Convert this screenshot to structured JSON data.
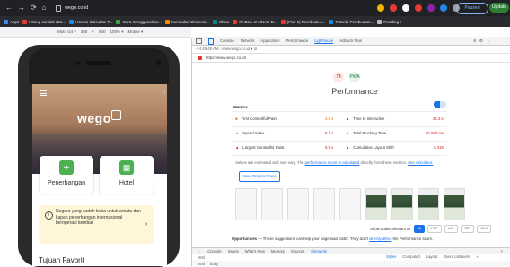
{
  "browser": {
    "url": "wego.co.id",
    "nav_glyphs": [
      "←",
      "→",
      "⟳",
      "⌂"
    ],
    "paused_label": "Paused",
    "update_label": "Update",
    "bookmarks": [
      {
        "label": "Apps",
        "color": "#4285f4"
      },
      {
        "label": "Hitung Jumlah (Da...",
        "color": "#e53935"
      },
      {
        "label": "How to Calculate T...",
        "color": "#1e88e5"
      },
      {
        "label": "Cara menggunakan...",
        "color": "#43a047"
      },
      {
        "label": "Kumpulan Ekstensi...",
        "color": "#fb8c00"
      },
      {
        "label": "Show",
        "color": "#00897b"
      },
      {
        "label": "RABUL JANNAH D...",
        "color": "#e53935"
      },
      {
        "label": "(Part 1) Membuat A...",
        "color": "#e53935"
      },
      {
        "label": "Tutorial Pembuatan...",
        "color": "#1e88e5"
      },
      {
        "label": "Reading li",
        "color": "#bdbdbd"
      }
    ]
  },
  "device_toolbar": {
    "device": "Moto G4 ▾",
    "width": "360",
    "x": "×",
    "height": "640",
    "zoom": "100% ▾",
    "throttle": "Mobile ▾"
  },
  "phone": {
    "logo": "wego",
    "cards": [
      {
        "label": "Penerbangan",
        "icon": "✈"
      },
      {
        "label": "Hotel",
        "icon": "▦"
      }
    ],
    "notice": "Negara yang sudah buka untuk wisata dan kapan penerbangan internasional beroperasi kembali",
    "notice_chevron": "›",
    "section_title": "Tujuan Favorit"
  },
  "devtools": {
    "tabs": [
      "Elements",
      "Console",
      "Network",
      "Application",
      "Performance",
      "Lighthouse",
      "Adblock Plus"
    ],
    "active_tab": "Lighthouse",
    "warnings": "8",
    "subbar": "+   4:48:48 AM - www.wego.co.id ▾   ⊘",
    "report_url": "https://www.wego.co.id/",
    "score_badge_a": "74",
    "score_badge_b": "PWA",
    "perf_title": "Performance",
    "metrics_heading": "Metrics",
    "metrics": [
      {
        "label": "First Contentful Paint",
        "value": "3.0 s",
        "status": "orange"
      },
      {
        "label": "Time to Interactive",
        "value": "22.3 s",
        "status": "red"
      },
      {
        "label": "Speed Index",
        "value": "9.1 s",
        "status": "red"
      },
      {
        "label": "Total Blocking Time",
        "value": "15,940 ms",
        "status": "red"
      },
      {
        "label": "Largest Contentful Paint",
        "value": "5.5 s",
        "status": "red"
      },
      {
        "label": "Cumulative Layout Shift",
        "value": "0.319",
        "status": "red"
      }
    ],
    "note_1": "Values are estimated and may vary. The",
    "note_link_1": "performance score is calculated",
    "note_2": "directly from these metrics.",
    "note_link_2": "See calculator.",
    "trace_button": "View Original Trace",
    "show_audits": "Show audits relevant to:",
    "audit_chips": [
      "All",
      "FCP",
      "LCP",
      "TBT",
      "CLS"
    ],
    "opps_label": "Opportunities",
    "opps_text": "— These suggestions can help your page load faster. They don't",
    "opps_link": "directly affect",
    "opps_tail": "the Performance score.",
    "drawer_tabs": [
      "Console",
      "Issues",
      "What's New",
      "Memory",
      "Sources",
      "Elements"
    ],
    "drawer_active": "Elements",
    "drawer_sub": "html",
    "drawer_sub2": [
      "html",
      "body"
    ],
    "style_tabs": [
      "Styles",
      "Computed",
      "Layout",
      "Event Listeners",
      "»"
    ]
  }
}
